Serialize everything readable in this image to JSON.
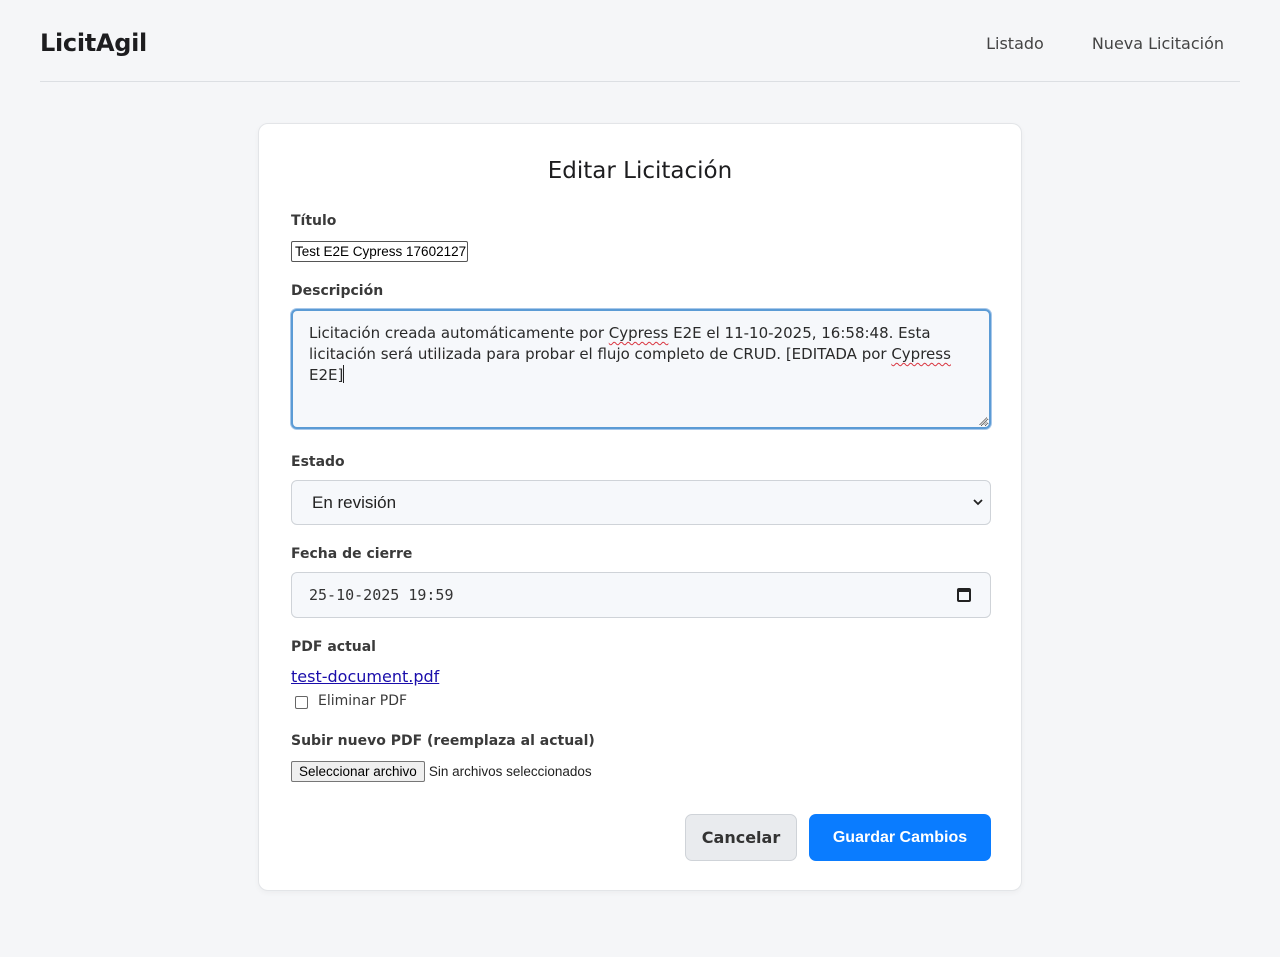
{
  "app": {
    "brand": "LicitAgil"
  },
  "nav": {
    "items": [
      {
        "label": "Listado"
      },
      {
        "label": "Nueva Licitación"
      }
    ]
  },
  "form": {
    "title": "Editar Licitación",
    "titulo": {
      "label": "Título",
      "value": "Test E2E Cypress 17602127"
    },
    "descripcion": {
      "label": "Descripción",
      "parts": [
        "Licitación creada automáticamente por ",
        "Cypress",
        " E2E el 11-10-2025, 16:58:48. Esta licitación será utilizada para probar el flujo completo de CRUD. [EDITADA por ",
        "Cypress",
        " E2E]"
      ]
    },
    "estado": {
      "label": "Estado",
      "value": "En revisión"
    },
    "fecha_cierre": {
      "label": "Fecha de cierre",
      "value": "25-10-2025 19:59"
    },
    "pdf_actual": {
      "label": "PDF actual",
      "filename": "test-document.pdf",
      "delete_label": "Eliminar PDF",
      "delete_checked": false
    },
    "subir_pdf": {
      "label": "Subir nuevo PDF (reemplaza al actual)",
      "button_label": "Seleccionar archivo",
      "status": "Sin archivos seleccionados"
    },
    "buttons": {
      "cancel": "Cancelar",
      "save": "Guardar Cambios"
    }
  },
  "icons": {
    "select": "chevron-down-icon",
    "date": "calendar-icon"
  },
  "colors": {
    "primary": "#0a7cff",
    "link": "#1a0dab",
    "focus": "#5b9bd5"
  }
}
